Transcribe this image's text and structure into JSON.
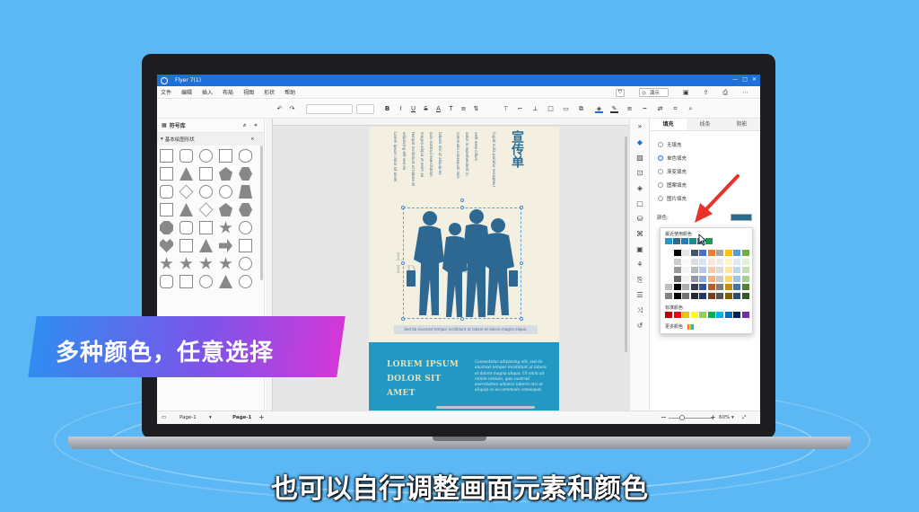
{
  "window": {
    "title": "Flyer 7(1)"
  },
  "menu": [
    "文件",
    "编辑",
    "插入",
    "布局",
    "视图",
    "形状",
    "帮助"
  ],
  "menu_right": {
    "present_label": "演示"
  },
  "left_panel": {
    "title": "符号库",
    "category": "基本绘图形状"
  },
  "flyer": {
    "title": "宣传单",
    "caption": "Sed do eiusmod tempor incididunt ut labore et dolore magna aliqua.",
    "ghost_line_1": "L          T",
    "ghost_line_2": "I D          ET",
    "heading_lines": [
      "LOREM IPSUM",
      "DOLOR SIT",
      "AMET"
    ],
    "body": "Consectetur adipiscing elit, sed do eiusmod tempor incididunt ut labore et dolore magna aliqua. Ut enim ad minim veniam, quis nostrud exercitation ullamco laboris nisi ut aliquip ex ea commodo consequat."
  },
  "fill_panel": {
    "tabs": [
      "填充",
      "线条",
      "阴影"
    ],
    "options": [
      "无填充",
      "单色填充",
      "渐变填充",
      "图案填充",
      "图片填充"
    ],
    "selected_option": "单色填充",
    "color_label": "颜色:",
    "current_color": "#2c6a8e"
  },
  "color_popup": {
    "recent_label": "最近使用颜色",
    "standard_label": "标准颜色",
    "more_label": "更多颜色",
    "recent_colors": [
      "#2398c2",
      "#2c6a8e",
      "#2b7bb9",
      "#1f8a8a",
      "#3a7fb0",
      "#1d9a5a"
    ],
    "standard_colors": [
      "#c00000",
      "#ff0000",
      "#ffc000",
      "#ffff00",
      "#92d050",
      "#00b050",
      "#00b0f0",
      "#0070c0",
      "#002060",
      "#7030a0"
    ]
  },
  "status": {
    "page_tab_1": "Page-1",
    "page_tab_2": "Page-1",
    "zoom": "60%"
  },
  "overlay": {
    "promo": "多种颜色，任意选择",
    "subtitle": "也可以自行调整画面元素和颜色"
  }
}
